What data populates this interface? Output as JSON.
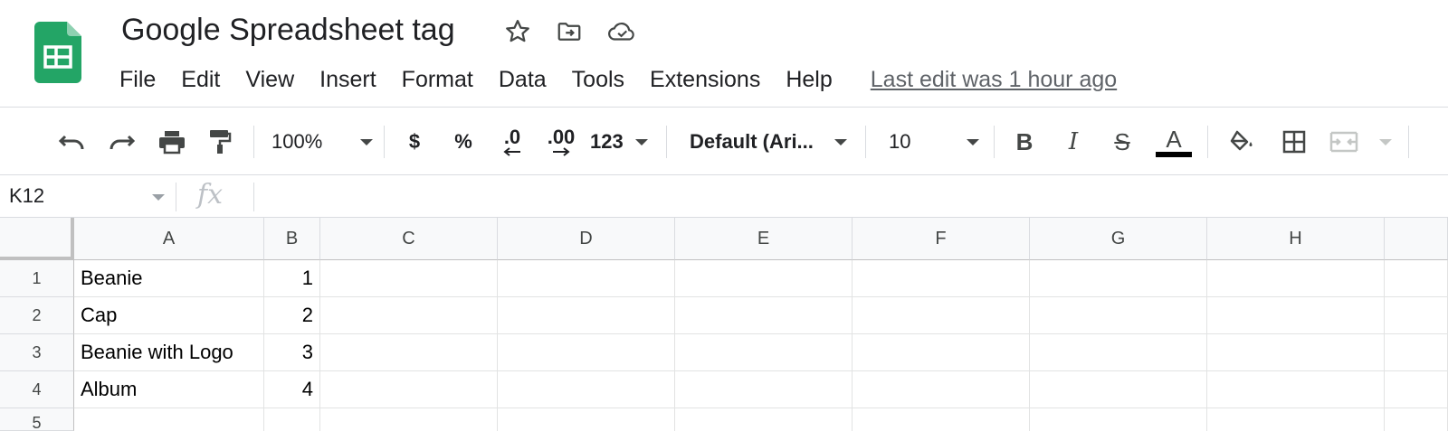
{
  "document": {
    "title": "Google Spreadsheet tag",
    "last_edit": "Last edit was 1 hour ago"
  },
  "menu": [
    "File",
    "Edit",
    "View",
    "Insert",
    "Format",
    "Data",
    "Tools",
    "Extensions",
    "Help"
  ],
  "toolbar": {
    "zoom": "100%",
    "currency": "$",
    "percent": "%",
    "decrease_decimals": ".0",
    "increase_decimals": ".00",
    "more_formats": "123",
    "font_family": "Default (Ari...",
    "font_size": "10",
    "bold": "B",
    "italic": "I",
    "strikethrough": "S",
    "text_color_glyph": "A",
    "text_color": "#000000"
  },
  "formula_bar": {
    "cell_reference": "K12",
    "fx_label": "fx",
    "content": ""
  },
  "grid": {
    "columns": [
      "A",
      "B",
      "C",
      "D",
      "E",
      "F",
      "G",
      "H"
    ],
    "row_numbers": [
      "1",
      "2",
      "3",
      "4",
      "5"
    ],
    "rows": [
      [
        "Beanie",
        "1"
      ],
      [
        "Cap",
        "2"
      ],
      [
        "Beanie with Logo",
        "3"
      ],
      [
        "Album",
        "4"
      ],
      [
        "",
        ""
      ]
    ]
  },
  "colors": {
    "sheets_green": "#23a566",
    "header_bg": "#f8f9fa",
    "grid_line": "#e2e3e3"
  }
}
